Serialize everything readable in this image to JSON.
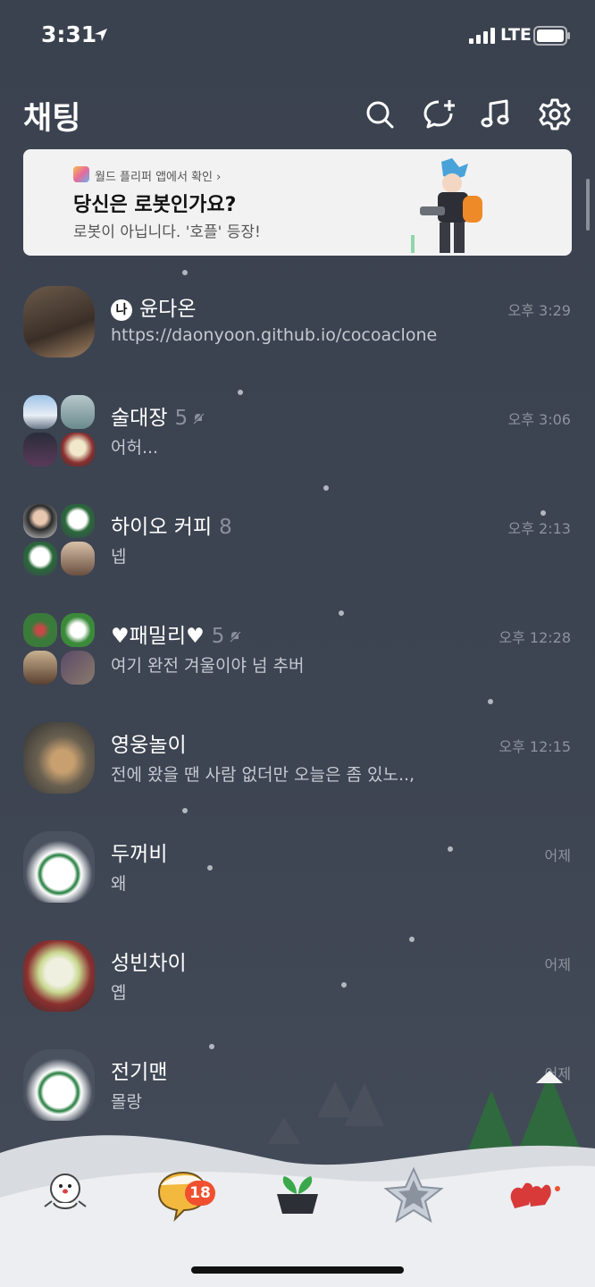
{
  "status_bar": {
    "time": "3:31",
    "network": "LTE"
  },
  "header": {
    "title": "채팅"
  },
  "banner": {
    "source": "월드 플리퍼 앱에서 확인 ›",
    "headline": "당신은 로봇인가요?",
    "subtext": "로봇이 아닙니다. '호플' 등장!"
  },
  "chats": [
    {
      "badge": "나",
      "name": "윤다온",
      "count": "",
      "message": "https://daonyoon.github.io/cocoaclone",
      "time": "오후 3:29",
      "muted": false
    },
    {
      "name": "술대장",
      "count": "5",
      "message": "어허...",
      "time": "오후 3:06",
      "muted": true
    },
    {
      "name": "하이오 커피",
      "count": "8",
      "message": "넵",
      "time": "오후 2:13",
      "muted": false
    },
    {
      "name": "♥패밀리♥",
      "count": "5",
      "message": "여기 완전 겨울이야 넘 추버",
      "time": "오후 12:28",
      "muted": true
    },
    {
      "name": "영웅놀이",
      "count": "",
      "message": "전에 왔을 땐 사람 없더만 오늘은 좀 있노..,",
      "time": "오후 12:15",
      "muted": false
    },
    {
      "name": "두꺼비",
      "count": "",
      "message": "왜",
      "time": "어제",
      "muted": false
    },
    {
      "name": "성빈차이",
      "count": "",
      "message": "옙",
      "time": "어제",
      "muted": false
    },
    {
      "name": "전기맨",
      "count": "",
      "message": "몰랑",
      "time": "어제",
      "muted": false
    }
  ],
  "tabbar": {
    "items": [
      {
        "icon": "friends-snowman-icon"
      },
      {
        "icon": "chat-bubble-icon",
        "badge": "18"
      },
      {
        "icon": "view-plant-icon"
      },
      {
        "icon": "shopping-star-icon"
      },
      {
        "icon": "more-mitten-icon"
      }
    ]
  }
}
